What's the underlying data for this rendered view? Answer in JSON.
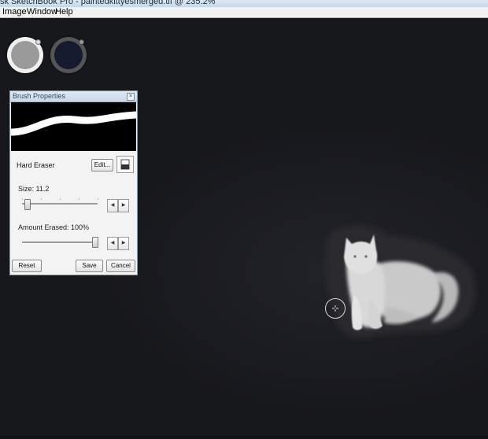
{
  "window": {
    "title": "sk SketchBook Pro - paintedkittyesmerged.tif @ 235.2%"
  },
  "menu": [
    {
      "label": "Image"
    },
    {
      "label": "Window"
    },
    {
      "label": "Help"
    }
  ],
  "colors": {
    "primary": "#9a9a9a",
    "secondary": "#151a2e",
    "canvas_background": "#17181c"
  },
  "brush_panel": {
    "title": "Brush Properties",
    "close_icon": "close-icon",
    "brush_name": "Hard Eraser",
    "edit_label": "Edit...",
    "size_label": "Size: 11.2",
    "size_value": 11.2,
    "amount_label": "Amount Erased: 100%",
    "amount_value": 100,
    "reset_label": "Reset",
    "save_label": "Save",
    "cancel_label": "Cancel"
  }
}
